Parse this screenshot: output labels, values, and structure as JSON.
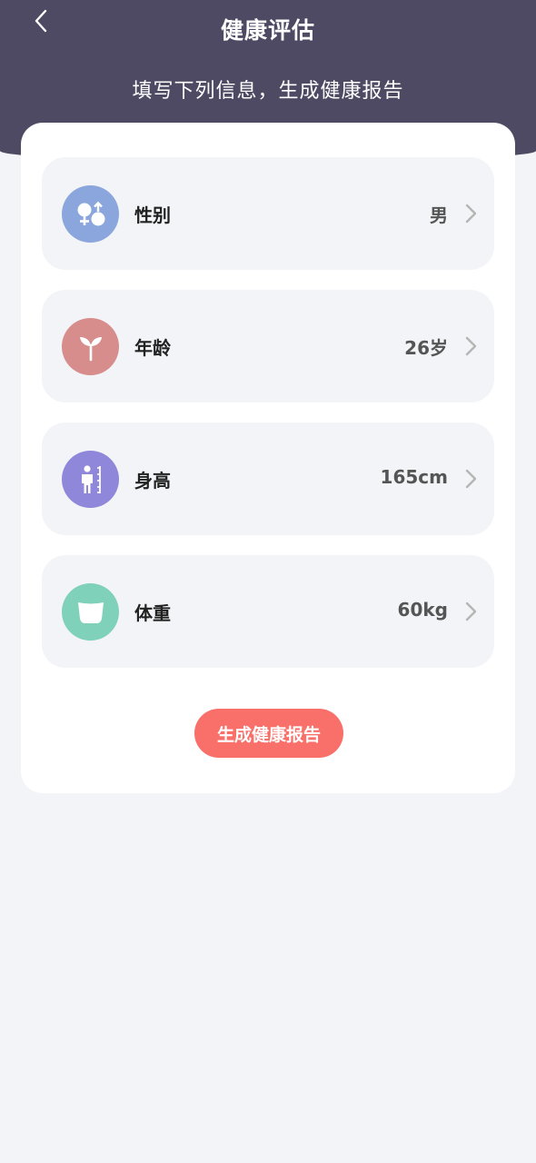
{
  "header": {
    "title": "健康评估",
    "subtitle": "填写下列信息，生成健康报告",
    "back_icon": "chevron-left-icon"
  },
  "colors": {
    "header_bg": "#4f4a63",
    "page_bg": "#f3f4f7",
    "card_bg": "#ffffff",
    "row_bg": "#f3f4f7",
    "button_bg": "#f96f69"
  },
  "form": {
    "rows": [
      {
        "label": "性别",
        "value": "男",
        "icon": "gender-icon",
        "icon_color": "#8ba6dc"
      },
      {
        "label": "年龄",
        "value": "26岁",
        "icon": "sprout-icon",
        "icon_color": "#d88d8d"
      },
      {
        "label": "身高",
        "value": "165cm",
        "icon": "height-ruler-icon",
        "icon_color": "#8f87da"
      },
      {
        "label": "体重",
        "value": "60kg",
        "icon": "weight-scale-icon",
        "icon_color": "#7fd1b9"
      }
    ]
  },
  "actions": {
    "generate_label": "生成健康报告"
  }
}
